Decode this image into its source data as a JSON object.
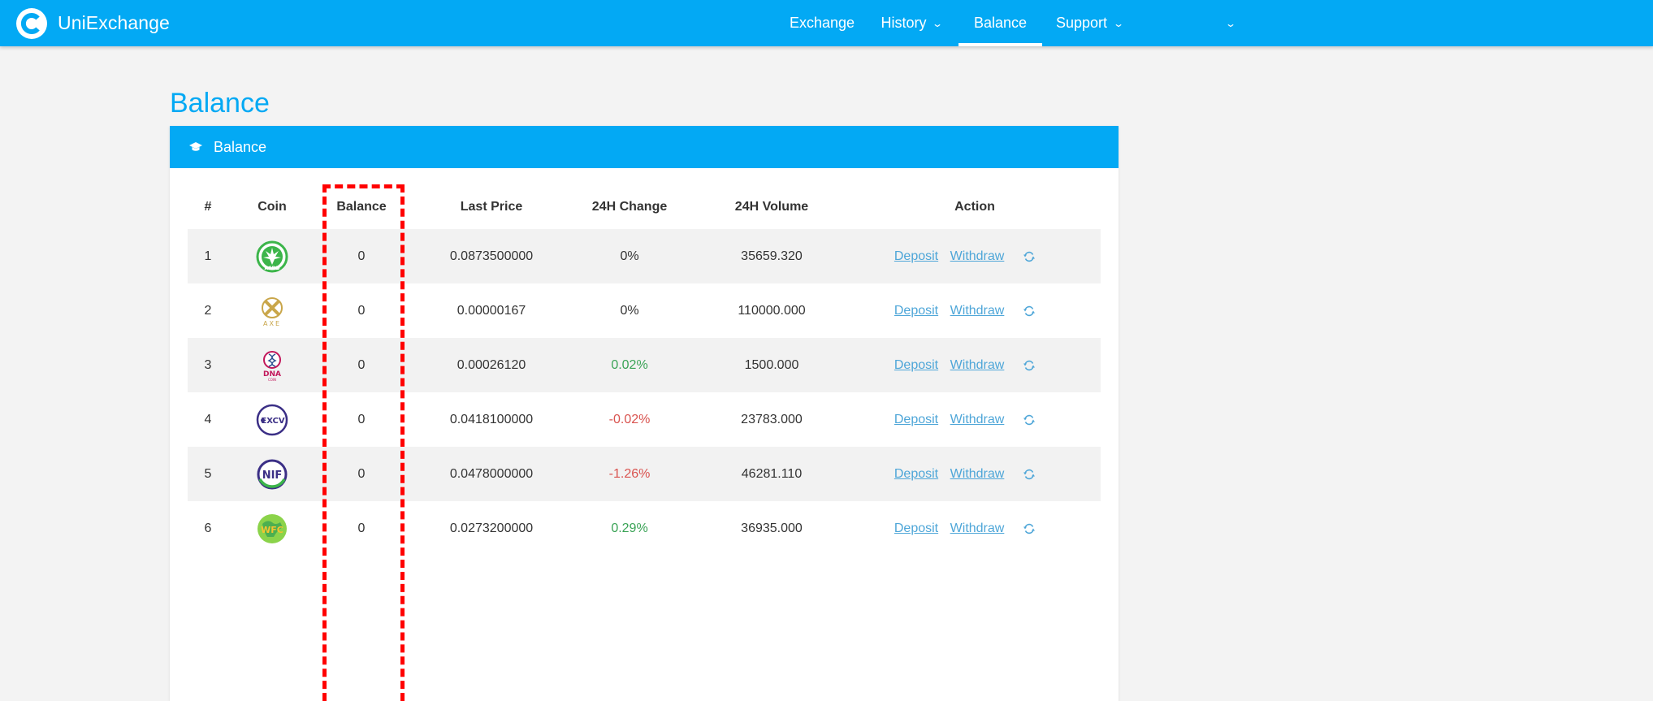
{
  "brand": {
    "name": "UniExchange"
  },
  "nav": [
    {
      "label": "Exchange",
      "dropdown": false,
      "active": false
    },
    {
      "label": "History",
      "dropdown": true,
      "active": false
    },
    {
      "label": "Balance",
      "dropdown": false,
      "active": true
    },
    {
      "label": "Support",
      "dropdown": true,
      "active": false
    },
    {
      "label": "",
      "dropdown": true,
      "active": false
    }
  ],
  "page": {
    "title": "Balance"
  },
  "card": {
    "title": "Balance"
  },
  "table": {
    "headers": [
      "#",
      "Coin",
      "Balance",
      "Last Price",
      "24H Change",
      "24H Volume",
      "Action"
    ],
    "actions": {
      "deposit": "Deposit",
      "withdraw": "Withdraw"
    },
    "rows": [
      {
        "index": "1",
        "coin_icon": "acdd-coin-icon",
        "balance": "0",
        "last_price": "0.0873500000",
        "change": "0%",
        "change_trend": "neutral",
        "volume": "35659.320"
      },
      {
        "index": "2",
        "coin_icon": "axe-coin-icon",
        "balance": "0",
        "last_price": "0.00000167",
        "change": "0%",
        "change_trend": "neutral",
        "volume": "110000.000"
      },
      {
        "index": "3",
        "coin_icon": "dna-coin-icon",
        "balance": "0",
        "last_price": "0.00026120",
        "change": "0.02%",
        "change_trend": "up",
        "volume": "1500.000"
      },
      {
        "index": "4",
        "coin_icon": "excv-coin-icon",
        "balance": "0",
        "last_price": "0.0418100000",
        "change": "-0.02%",
        "change_trend": "down",
        "volume": "23783.000"
      },
      {
        "index": "5",
        "coin_icon": "nif-coin-icon",
        "balance": "0",
        "last_price": "0.0478000000",
        "change": "-1.26%",
        "change_trend": "down",
        "volume": "46281.110"
      },
      {
        "index": "6",
        "coin_icon": "wfc-coin-icon",
        "balance": "0",
        "last_price": "0.0273200000",
        "change": "0.29%",
        "change_trend": "up",
        "volume": "36935.000"
      }
    ]
  },
  "colors": {
    "primary": "#03a9f4",
    "positive": "#3aa356",
    "negative": "#d9534f",
    "link": "#4ea6d8",
    "highlight": "#ff0000"
  }
}
